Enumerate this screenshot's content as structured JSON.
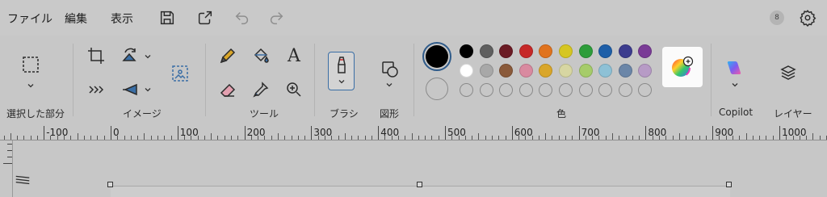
{
  "menu": {
    "file": "ファイル",
    "edit": "編集",
    "view": "表示"
  },
  "quick_actions": [
    "save-icon",
    "share-icon",
    "undo-icon",
    "redo-icon"
  ],
  "account": {
    "avatar_glyph": "8"
  },
  "ribbon": {
    "groups": {
      "selection": "選択した部分",
      "image": "イメージ",
      "tools": "ツール",
      "brush": "ブラシ",
      "shapes": "図形",
      "colors": "色",
      "copilot": "Copilot",
      "layers": "レイヤー"
    },
    "text_tool_glyph": "A"
  },
  "colors": {
    "primary": "#000000",
    "accent": "#3a6ea5",
    "row1": [
      "#000000",
      "#5f5f5f",
      "#6b1b24",
      "#c62828",
      "#e0731e",
      "#d6c622",
      "#2e9d3a",
      "#1e5fa8",
      "#3c3c8e",
      "#7a3b96"
    ],
    "row2": [
      "#ffffff",
      "#a8a8a8",
      "#8a5a3a",
      "#d98aa0",
      "#d9a62a",
      "#d7d6a2",
      "#a6cc6a",
      "#8ec1d6",
      "#6b86a8",
      "#b79bc6"
    ]
  },
  "ruler": {
    "labels": [
      "-100",
      "0",
      "100",
      "200",
      "300",
      "400",
      "500",
      "600",
      "700",
      "800",
      "900",
      "1000"
    ]
  }
}
